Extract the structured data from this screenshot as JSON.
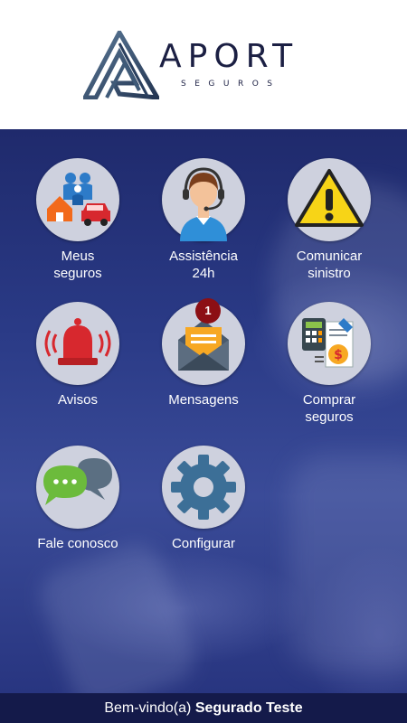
{
  "brand": {
    "name": "APORT",
    "tagline": "SEGUROS"
  },
  "menu": [
    {
      "line1": "Meus",
      "line2": "seguros",
      "icon": "family-icon"
    },
    {
      "line1": "Assistência",
      "line2": "24h",
      "icon": "headset-agent-icon"
    },
    {
      "line1": "Comunicar",
      "line2": "sinistro",
      "icon": "warning-icon"
    },
    {
      "line1": "Avisos",
      "line2": "",
      "icon": "alarm-bell-icon"
    },
    {
      "line1": "Mensagens",
      "line2": "",
      "icon": "envelope-icon",
      "badge": "1"
    },
    {
      "line1": "Comprar",
      "line2": "seguros",
      "icon": "calculator-money-icon"
    },
    {
      "line1": "Fale conosco",
      "line2": "",
      "icon": "chat-bubbles-icon"
    },
    {
      "line1": "Configurar",
      "line2": "",
      "icon": "gear-icon"
    }
  ],
  "footer": {
    "greeting": "Bem-vindo(a)",
    "user": "Segurado Teste"
  },
  "colors": {
    "header_bg": "#ffffff",
    "footer_bg": "#141a4a",
    "circle_bg": "#ced1de",
    "badge_bg": "#8c0f14"
  }
}
